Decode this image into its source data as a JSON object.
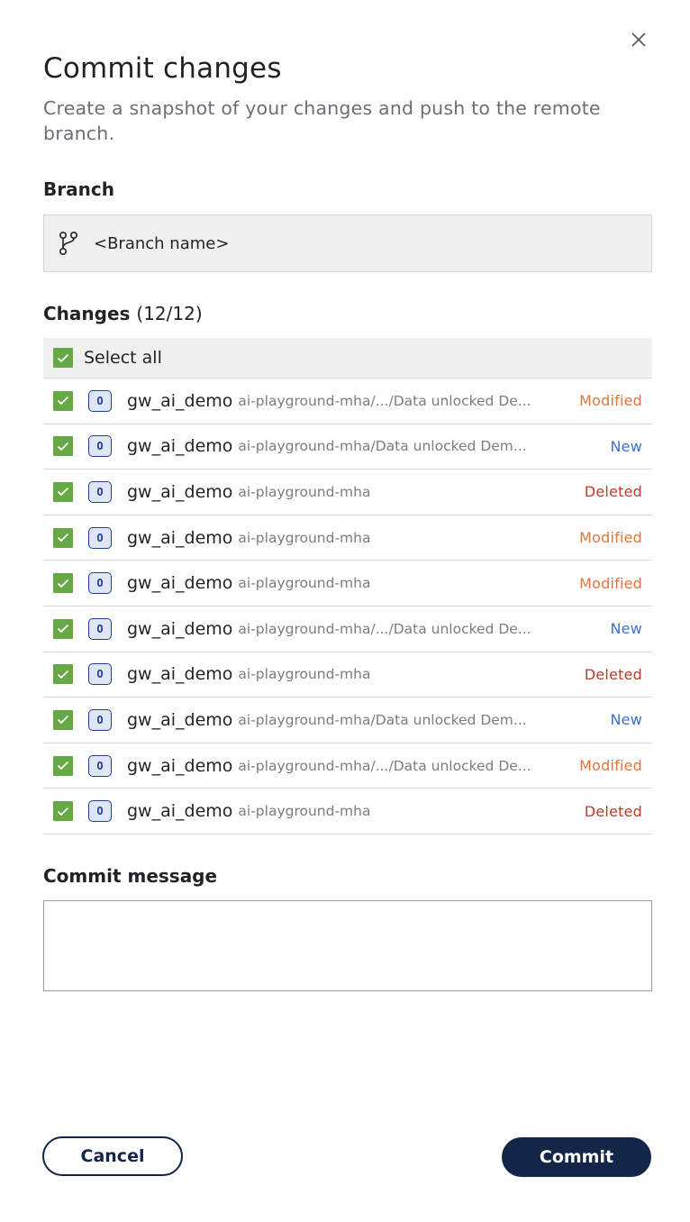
{
  "dialog": {
    "title": "Commit changes",
    "subtitle": "Create a snapshot of your changes and push to the remote branch."
  },
  "branch": {
    "label": "Branch",
    "name": "<Branch name>",
    "icon": "git-branch-icon"
  },
  "changes": {
    "label": "Changes",
    "count": "(12/12)",
    "select_all_label": "Select all",
    "select_all_checked": true,
    "items": [
      {
        "name": "gw_ai_demo",
        "path": "ai-playground-mha/.../Data unlocked De...",
        "status": "Modified",
        "kind": "modified",
        "checked": true
      },
      {
        "name": "gw_ai_demo",
        "path": "ai-playground-mha/Data unlocked Dem...",
        "status": "New",
        "kind": "new",
        "checked": true
      },
      {
        "name": "gw_ai_demo",
        "path": "ai-playground-mha",
        "status": "Deleted",
        "kind": "deleted",
        "checked": true
      },
      {
        "name": "gw_ai_demo",
        "path": "ai-playground-mha",
        "status": "Modified",
        "kind": "modified",
        "checked": true
      },
      {
        "name": "gw_ai_demo",
        "path": "ai-playground-mha",
        "status": "Modified",
        "kind": "modified",
        "checked": true
      },
      {
        "name": "gw_ai_demo",
        "path": "ai-playground-mha/.../Data unlocked De...",
        "status": "New",
        "kind": "new",
        "checked": true
      },
      {
        "name": "gw_ai_demo",
        "path": "ai-playground-mha",
        "status": "Deleted",
        "kind": "deleted",
        "checked": true
      },
      {
        "name": "gw_ai_demo",
        "path": "ai-playground-mha/Data unlocked Dem...",
        "status": "New",
        "kind": "new",
        "checked": true
      },
      {
        "name": "gw_ai_demo",
        "path": "ai-playground-mha/.../Data unlocked De...",
        "status": "Modified",
        "kind": "modified",
        "checked": true
      },
      {
        "name": "gw_ai_demo",
        "path": "ai-playground-mha",
        "status": "Deleted",
        "kind": "deleted",
        "checked": true
      }
    ],
    "type_icon_letter": "O"
  },
  "commit_message": {
    "label": "Commit message",
    "value": "",
    "placeholder": ""
  },
  "actions": {
    "cancel_label": "Cancel",
    "commit_label": "Commit"
  },
  "colors": {
    "checkbox": "#66a844",
    "modified": "#e07340",
    "new": "#3d6fd1",
    "deleted": "#c0392b",
    "primary": "#14254a"
  }
}
